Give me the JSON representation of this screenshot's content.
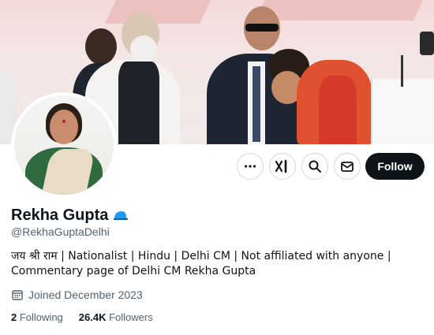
{
  "banner": {
    "alt_theme": "event-photo"
  },
  "profile": {
    "name": "Rekha Gupta",
    "handle": "@RekhaGuptaDelhi",
    "bio": "जय श्री राम | Nationalist | Hindu | Delhi CM | Not affiliated with anyone | Commentary page of Delhi CM Rekha Gupta",
    "joined": "Joined December 2023",
    "following_count": "2",
    "following_label": "Following",
    "followers_count": "26.4K",
    "followers_label": "Followers"
  },
  "actions": {
    "more_icon": "more-dots-icon",
    "grok_icon": "xai-grok-icon",
    "search_icon": "search-icon",
    "message_icon": "mail-icon",
    "follow_label": "Follow"
  },
  "colors": {
    "text_primary": "#0f1419",
    "text_secondary": "#536471",
    "follow_button": "#0f1419",
    "badge": "#1d9bf0"
  }
}
